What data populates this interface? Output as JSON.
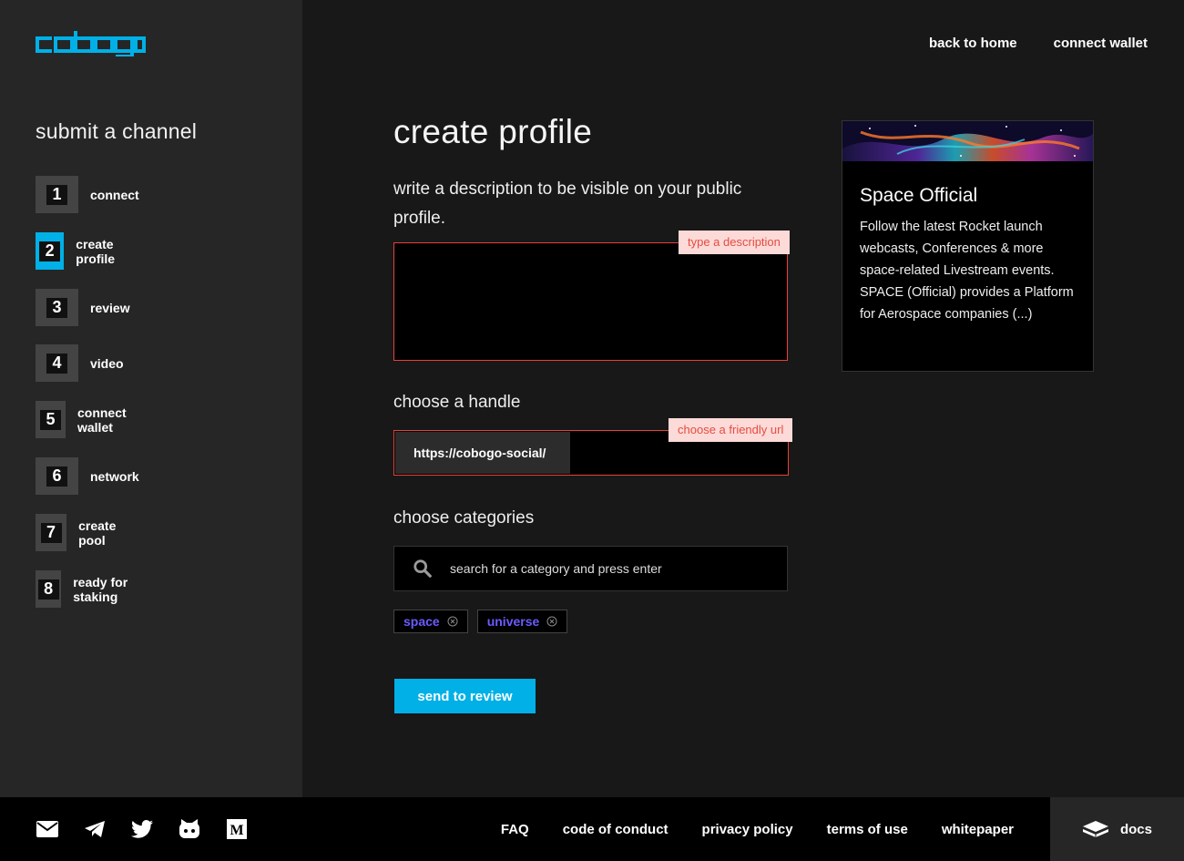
{
  "brand": {
    "logo_text": "cobogo",
    "accent": "#00b0e6",
    "error": "#e8413a",
    "tag_color": "#6a5cff"
  },
  "topnav": {
    "back_home": "back to home",
    "connect_wallet": "connect wallet"
  },
  "sidebar": {
    "title": "submit a channel",
    "steps": [
      {
        "num": "1",
        "label": "connect"
      },
      {
        "num": "2",
        "label": "create profile",
        "active": true
      },
      {
        "num": "3",
        "label": "review"
      },
      {
        "num": "4",
        "label": "video"
      },
      {
        "num": "5",
        "label": "connect wallet"
      },
      {
        "num": "6",
        "label": "network"
      },
      {
        "num": "7",
        "label": "create pool"
      },
      {
        "num": "8",
        "label": "ready for staking"
      }
    ]
  },
  "form": {
    "title": "create profile",
    "description_label": "write a description to be visible on your public profile.",
    "description_value": "",
    "description_error": "type a description",
    "handle_label": "choose a handle",
    "handle_prefix": "https://cobogo-social/",
    "handle_value": "",
    "handle_error": "choose a friendly url",
    "categories_label": "choose categories",
    "search_placeholder": "search for a category and press enter",
    "tags": [
      "space",
      "universe"
    ],
    "submit_label": "send to review"
  },
  "preview": {
    "title": "Space Official",
    "description": "Follow the latest Rocket launch webcasts, Conferences & more space-related Livestream events. SPACE (Official) provides a Platform for Aerospace companies (...)"
  },
  "footer": {
    "social_icons": [
      "mail-icon",
      "telegram-icon",
      "twitter-icon",
      "github-icon",
      "medium-icon"
    ],
    "links": [
      "FAQ",
      "code of conduct",
      "privacy policy",
      "terms of use",
      "whitepaper"
    ],
    "docs_label": "docs"
  }
}
